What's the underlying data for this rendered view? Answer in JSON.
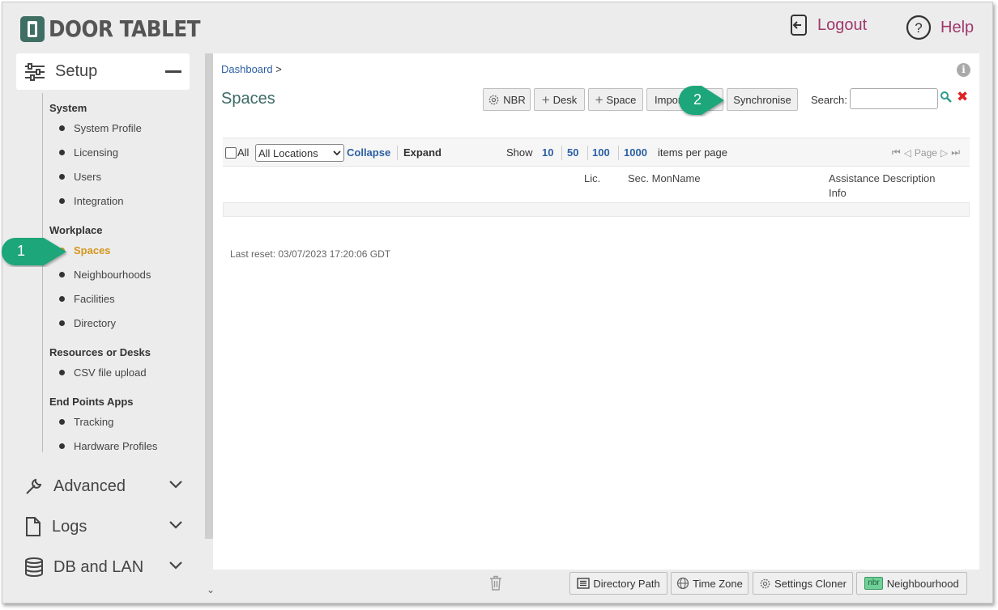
{
  "brand": {
    "name": "DOOR TABLET"
  },
  "header": {
    "logout": "Logout",
    "help": "Help"
  },
  "sidebar": {
    "setup": "Setup",
    "groups": {
      "system": "System",
      "workplace": "Workplace",
      "resources": "Resources or Desks",
      "endpoints": "End Points Apps"
    },
    "items": {
      "system_profile": "System Profile",
      "licensing": "Licensing",
      "users": "Users",
      "integration": "Integration",
      "spaces": "Spaces",
      "neighbourhoods": "Neighbourhoods",
      "facilities": "Facilities",
      "directory": "Directory",
      "csv": "CSV file upload",
      "tracking": "Tracking",
      "hardware": "Hardware Profiles"
    },
    "advanced": "Advanced",
    "logs": "Logs",
    "db": "DB and LAN"
  },
  "main": {
    "breadcrumb": "Dashboard",
    "breadcrumb_sep": ">",
    "title": "Spaces",
    "toolbar": {
      "nbr": "NBR",
      "desk": "Desk",
      "space": "Space",
      "import": "Import",
      "synchronise": "Synchronise"
    },
    "search_label": "Search:",
    "search_value": "",
    "grid": {
      "all": "All",
      "location": "All Locations",
      "collapse": "Collapse",
      "expand": "Expand",
      "show": "Show",
      "page_sizes": [
        "10",
        "50",
        "100",
        "1000"
      ],
      "per_page": "items per page",
      "page": "Page"
    },
    "columns": {
      "lic": "Lic.",
      "sec_mon": "Sec. MonName",
      "assist": "Assistance Description",
      "info": "Info"
    },
    "last_reset": "Last reset: 03/07/2023 17:20:06 GDT"
  },
  "bottom": {
    "directory_path": "Directory Path",
    "time_zone": "Time Zone",
    "settings_cloner": "Settings Cloner",
    "nbr_badge": "nbr",
    "neighbourhood": "Neighbourhood"
  },
  "callouts": [
    "1",
    "2"
  ],
  "colors": {
    "accent": "#a0396b",
    "active": "#d4961d",
    "link": "#2b5fa3",
    "callout": "#1aa67a"
  }
}
